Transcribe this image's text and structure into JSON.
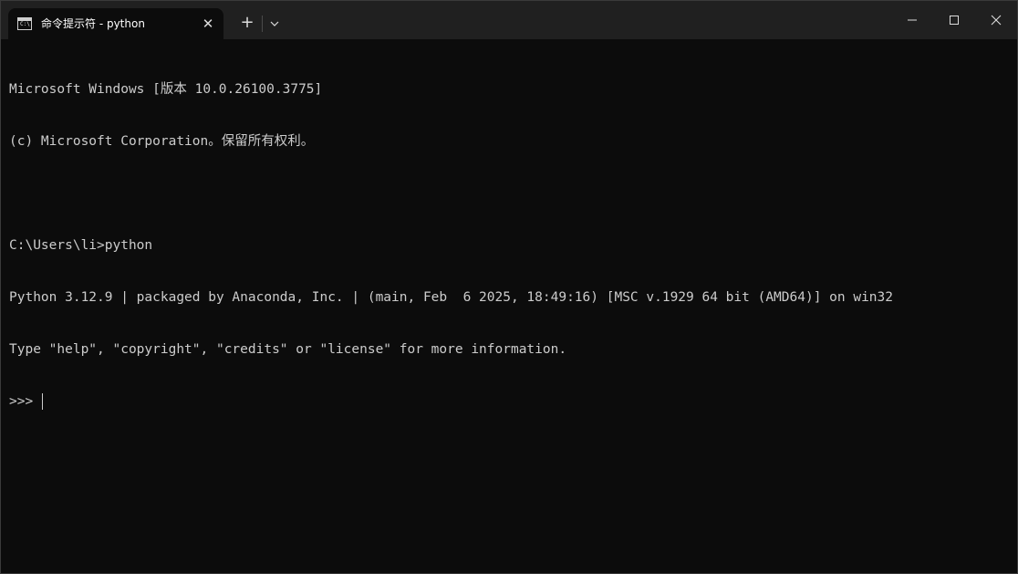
{
  "tab": {
    "title": "命令提示符 - python",
    "icon": "cmd-icon",
    "icon_text": "C:\\",
    "close_symbol": "✕"
  },
  "titlebar": {
    "new_tab_symbol": "+",
    "dropdown_icon": "chevron-down-icon",
    "minimize_icon": "minimize-icon",
    "maximize_icon": "maximize-icon",
    "close_icon": "close-icon"
  },
  "console": {
    "lines": [
      "Microsoft Windows [版本 10.0.26100.3775]",
      "(c) Microsoft Corporation。保留所有权利。",
      "",
      "C:\\Users\\li>python",
      "Python 3.12.9 | packaged by Anaconda, Inc. | (main, Feb  6 2025, 18:49:16) [MSC v.1929 64 bit (AMD64)] on win32",
      "Type \"help\", \"copyright\", \"credits\" or \"license\" for more information.",
      ">>> "
    ]
  },
  "colors": {
    "background": "#0c0c0c",
    "titlebar": "#202020",
    "text": "#cccccc"
  }
}
